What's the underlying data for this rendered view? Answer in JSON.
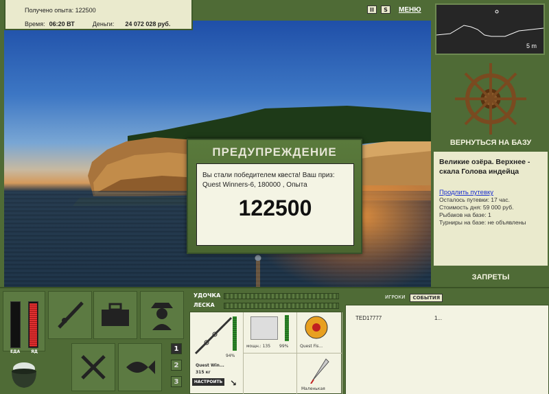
{
  "info": {
    "xp_label": "Получено опыта:",
    "xp_value": "122500",
    "time_label": "Время:",
    "time_value": "06:20 ВТ",
    "money_label": "Деньги:",
    "money_value": "24 072 028 руб."
  },
  "top_icons": {
    "pause": "II",
    "sound": "S",
    "menu": "МЕНЮ"
  },
  "minimap": {
    "depth": "5 m"
  },
  "right": {
    "return_label": "ВЕРНУТЬСЯ НА БАЗУ",
    "location_title": "Великие озёра. Верхнее - скала Голова индейца",
    "extend_link": "Продлить путевку",
    "remaining": "Осталось путевки: 17 час.",
    "day_cost": "Стоимость дня: 59 000 руб.",
    "fishers": "Рыбаков на базе: 1",
    "tournaments": "Турниры на базе: не объявлены",
    "bans_label": "ЗАПРЕТЫ"
  },
  "modal": {
    "title": "ПРЕДУПРЕЖДЕНИЕ",
    "text": "Вы стали победителем квеста! Ваш приз: Quest Winners-6, 180000 , Опыта",
    "value": "122500"
  },
  "bottom": {
    "food_label": "ЕДА",
    "bait_label": "ЯД",
    "food_level": 0.0,
    "bait_level": 0.95,
    "slots": [
      "1",
      "2",
      "3"
    ],
    "rod_label": "УДОЧКА",
    "line_label": "ЛЕСКА",
    "rod_name": "Quest Win...",
    "rod_weight": "315 кг",
    "rod_percent": "94%",
    "reel_label": "мощн.: 135",
    "reel_percent": "99%",
    "line_name": "Quest Fis...",
    "lure_name": "Маленькая",
    "setup_button": "НАСТРОИТЬ"
  },
  "chat": {
    "tabs": [
      "ИГРОКИ",
      "СОБЫТИЯ"
    ],
    "rows": [
      {
        "name": "TED17777",
        "value": "1..."
      }
    ]
  },
  "colors": {
    "panel_green": "#4f6b36",
    "panel_cream": "#eaeacd",
    "meter_red": "#e03030"
  }
}
